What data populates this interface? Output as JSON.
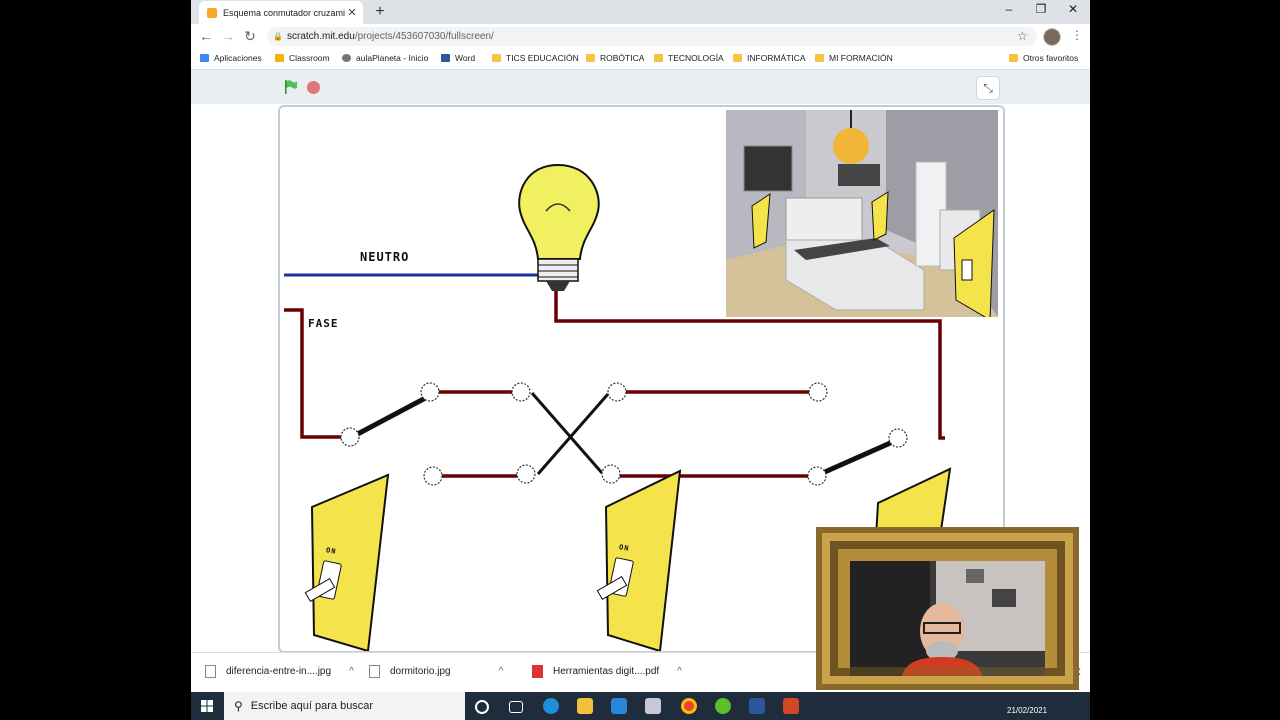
{
  "browser": {
    "tab_title": "Esquema conmutador cruzamien",
    "tab_close": "✕",
    "new_tab": "+",
    "window_controls": {
      "minimize": "–",
      "restore": "❐",
      "close": "✕"
    },
    "nav": {
      "back": "←",
      "forward": "→",
      "reload": "↻"
    },
    "url_host": "scratch.mit.edu",
    "url_path": "/projects/453607030/fullscreen/",
    "bookmark_star": "☆",
    "menu": "⋮"
  },
  "bookmarks": [
    {
      "label": "Aplicaciones",
      "icon": "apps-grid-icon",
      "color": "#4285f4"
    },
    {
      "label": "Classroom",
      "icon": "classroom-icon",
      "color": "#f2b400"
    },
    {
      "label": "aulaPlaneta - Inicio",
      "icon": "globe-icon",
      "color": "#777777"
    },
    {
      "label": "Word",
      "icon": "word-icon",
      "color": "#2b579a"
    },
    {
      "label": "TICS EDUCACIÓN",
      "icon": "folder-icon",
      "color": "#f6c342"
    },
    {
      "label": "ROBÓTICA",
      "icon": "folder-icon",
      "color": "#f6c342"
    },
    {
      "label": "TECNOLOGÍA",
      "icon": "folder-icon",
      "color": "#f6c342"
    },
    {
      "label": "INFORMÁTICA",
      "icon": "folder-icon",
      "color": "#f6c342"
    },
    {
      "label": "MI FORMACIÓN",
      "icon": "folder-icon",
      "color": "#f6c342"
    }
  ],
  "other_bookmarks": {
    "label": "Otros favoritos",
    "icon": "folder-icon",
    "color": "#f6c342"
  },
  "scratch": {
    "fullscreen_icon": "⤡",
    "labels": {
      "neutro": "NEUTRO",
      "fase": "FASE"
    },
    "switch_on_label": "ON",
    "colors": {
      "phase_wire": "#6b0000",
      "neutral_wire": "#1a2ea0",
      "switch_plate": "#f4e34a",
      "bulb": "#f0f060"
    }
  },
  "downloads": [
    {
      "name": "diferencia-entre-in....jpg",
      "icon": "image-file-icon"
    },
    {
      "name": "dormitorio.jpg",
      "icon": "image-file-icon"
    },
    {
      "name": "Herramientas digit....pdf",
      "icon": "pdf-file-icon"
    }
  ],
  "downloads_close": "✕",
  "taskbar": {
    "search_placeholder": "Escribe aquí para buscar",
    "date": "21/02/2021"
  }
}
